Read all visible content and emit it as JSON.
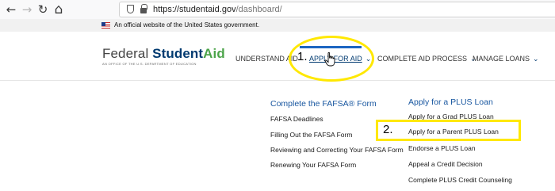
{
  "browser": {
    "back_icon": "←",
    "forward_icon": "→",
    "reload_icon": "↻",
    "home_icon": "⌂",
    "url_host": "https://studentaid.gov",
    "url_path": "/dashboard/"
  },
  "banner": {
    "text": "An official website of the United States government."
  },
  "logo": {
    "part1": "Federal ",
    "part2": "Student",
    "part3": "Aid",
    "tagline": "An office of the U.S. Department of Education"
  },
  "nav": {
    "items": [
      {
        "label": "UNDERSTAND AID",
        "chevron": ""
      },
      {
        "label": "APPLY FOR AID",
        "chevron": "⌄"
      },
      {
        "label": "COMPLETE AID PROCESS",
        "chevron": "⌄"
      },
      {
        "label": "MANAGE LOANS",
        "chevron": "⌄"
      }
    ]
  },
  "dropdown": {
    "columns": [
      {
        "heading": "Complete the FAFSA® Form",
        "links": [
          "FAFSA Deadlines",
          "Filling Out the FAFSA Form",
          "Reviewing and Correcting Your FAFSA Form",
          "Renewing Your FAFSA Form"
        ]
      },
      {
        "heading": "Apply for a PLUS Loan",
        "links": [
          "Apply for a Grad PLUS Loan",
          "Apply for a Parent PLUS Loan",
          "Endorse a PLUS Loan",
          "Appeal a Credit Decision",
          "Complete PLUS Credit Counseling"
        ]
      }
    ]
  },
  "annotations": {
    "step1": "1.",
    "step2": "2."
  },
  "colors": {
    "annotation": "#ffe800",
    "brand_blue": "#003a70",
    "brand_green": "#4ca44a",
    "link_heading": "#1957a0"
  }
}
